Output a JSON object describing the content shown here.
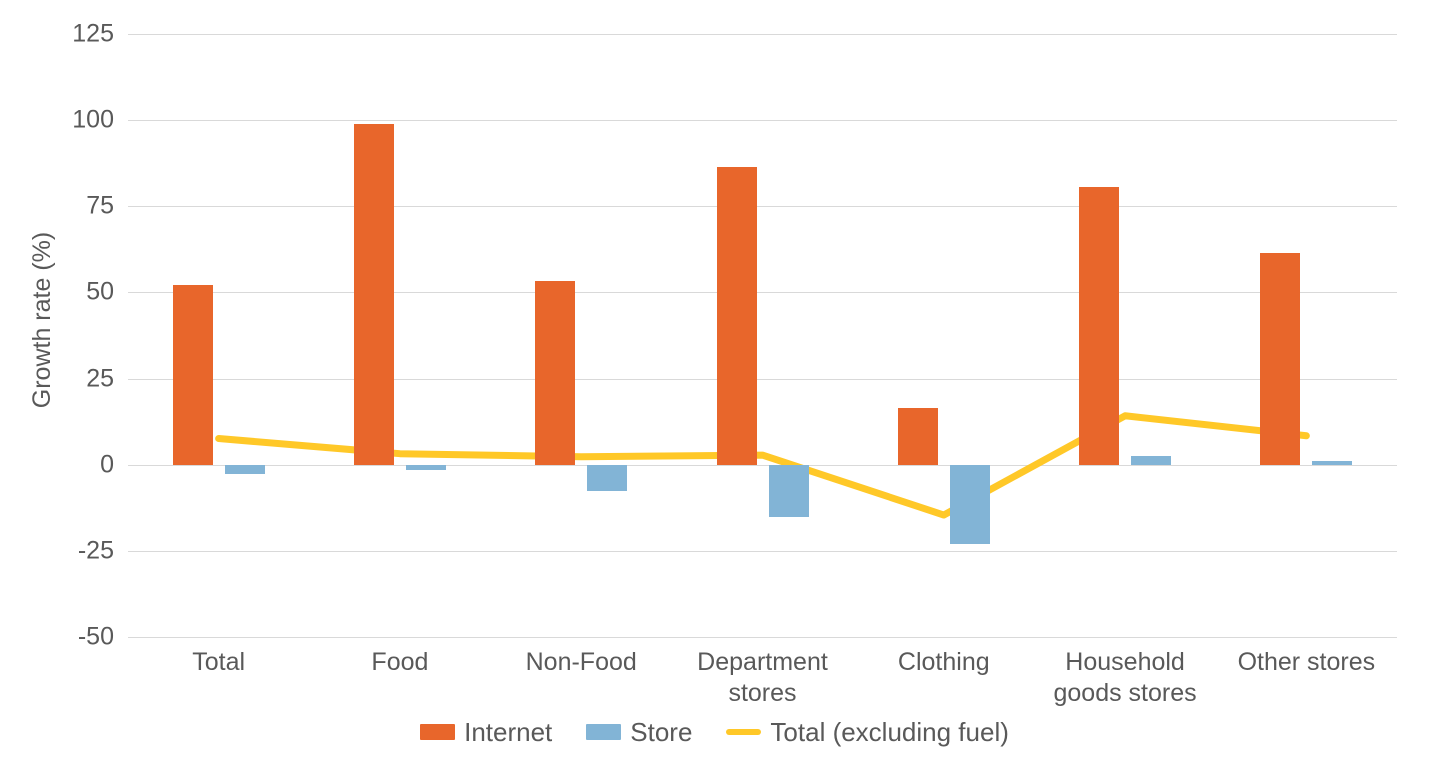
{
  "chart_data": {
    "type": "bar",
    "title": "",
    "subtitle": "",
    "xlabel": "",
    "ylabel": "Growth rate (%)",
    "ylim": [
      -50,
      125
    ],
    "yticks": [
      125,
      100,
      75,
      50,
      25,
      0,
      -25,
      -50
    ],
    "ytick_labels": [
      "125",
      "100",
      "75",
      "50",
      "25",
      "0",
      "-25",
      "-50"
    ],
    "grid": true,
    "legend_position": "bottom",
    "categories": [
      "Total",
      "Food",
      "Non-Food",
      "Department stores",
      "Clothing",
      "Household goods stores",
      "Other stores"
    ],
    "series": [
      {
        "name": "Internet",
        "type": "bar",
        "color": "#E8662B",
        "values": [
          52.3,
          99.0,
          53.2,
          86.5,
          16.4,
          80.6,
          61.5
        ]
      },
      {
        "name": "Store",
        "type": "bar",
        "color": "#82B4D6",
        "values": [
          -2.6,
          -1.5,
          -7.5,
          -15.3,
          -23.1,
          2.6,
          1.0
        ]
      },
      {
        "name": "Total (excluding fuel)",
        "type": "line",
        "color": "#FFC828",
        "values": [
          7.6,
          3.2,
          2.3,
          2.8,
          -14.6,
          14.2,
          8.4
        ]
      }
    ]
  },
  "legend": {
    "items": [
      {
        "label": "Internet",
        "color": "#E8662B",
        "marker": "square"
      },
      {
        "label": "Store",
        "color": "#82B4D6",
        "marker": "square"
      },
      {
        "label": "Total (excluding fuel)",
        "color": "#FFC828",
        "marker": "line"
      }
    ]
  },
  "axis": {
    "y_title": "Growth rate (%)"
  },
  "colors": {
    "internet": "#E8662B",
    "store": "#82B4D6",
    "total_line": "#FFC828",
    "gridline": "#d9d9d9",
    "text": "#595959",
    "background": "#ffffff"
  }
}
